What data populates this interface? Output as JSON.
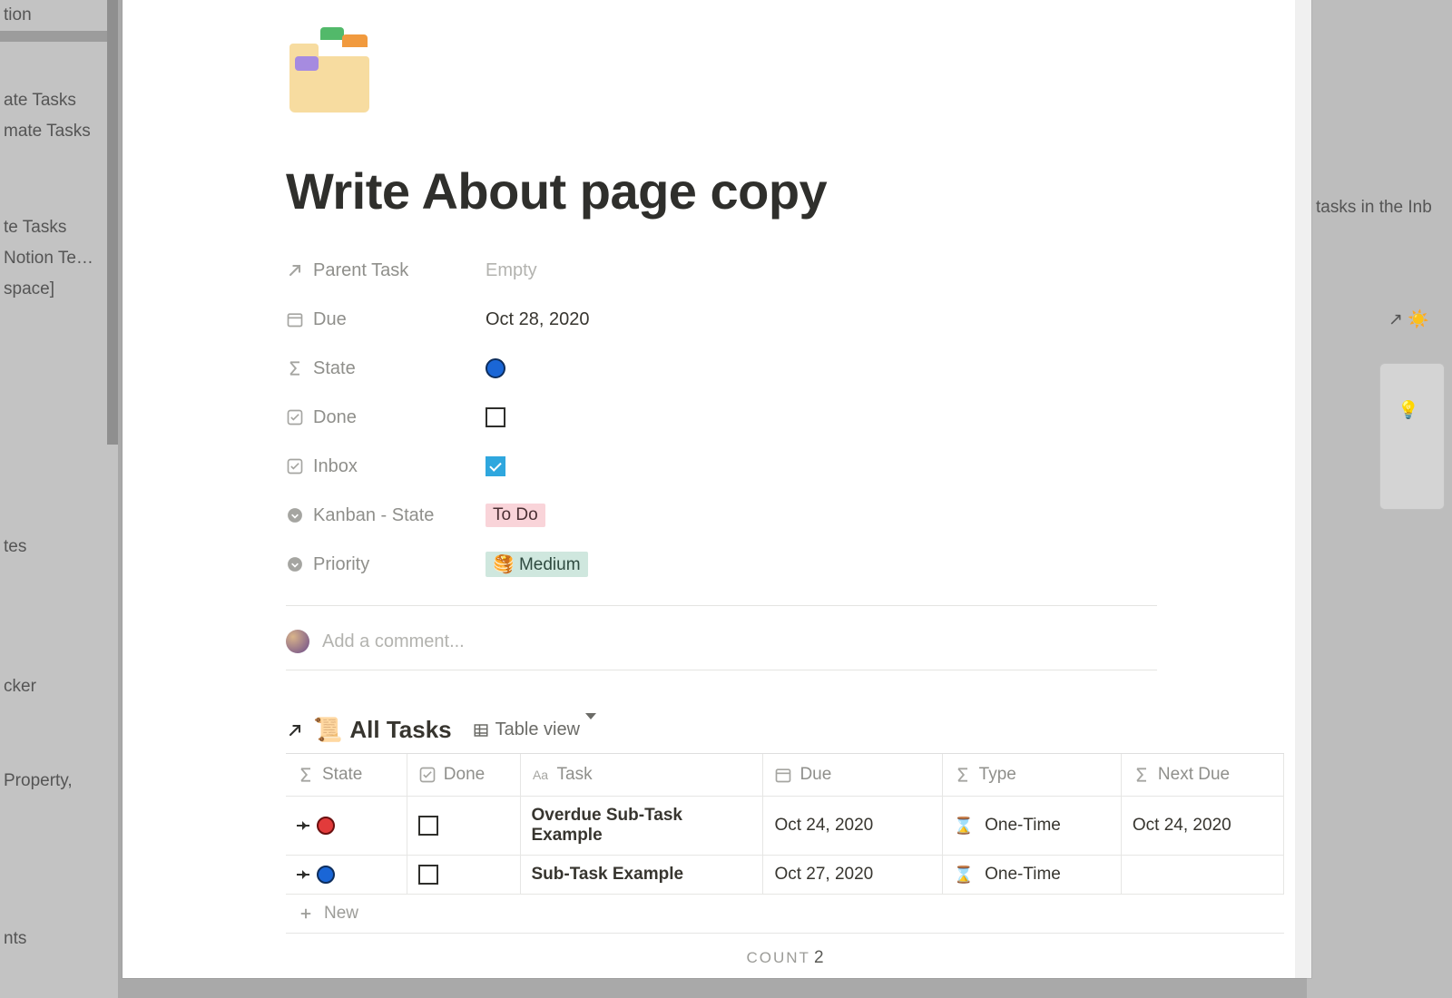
{
  "background": {
    "sidebar_items": [
      "tion",
      "",
      "ate Tasks",
      "mate Tasks",
      "",
      "",
      "te Tasks",
      "Notion Te…",
      "space]",
      "",
      "",
      "",
      "",
      "tes",
      "",
      "",
      "cker",
      "",
      "",
      "Property,",
      "",
      "",
      "",
      "nts"
    ],
    "right_text": "tasks in the Inb"
  },
  "page": {
    "title": "Write About page copy",
    "properties": {
      "parent_task": {
        "label": "Parent Task",
        "value": "",
        "placeholder": "Empty"
      },
      "due": {
        "label": "Due",
        "value": "Oct 28, 2020"
      },
      "state": {
        "label": "State",
        "color": "#1a66d6"
      },
      "done": {
        "label": "Done",
        "checked": false
      },
      "inbox": {
        "label": "Inbox",
        "checked": true
      },
      "kanban": {
        "label": "Kanban - State",
        "tag": "To Do"
      },
      "priority": {
        "label": "Priority",
        "tag": "Medium",
        "emoji": "🥞"
      }
    },
    "comment_placeholder": "Add a comment..."
  },
  "linked_db": {
    "title": "All Tasks",
    "title_emoji": "📜",
    "view_label": "Table view",
    "columns": {
      "state": "State",
      "done": "Done",
      "task": "Task",
      "due": "Due",
      "type": "Type",
      "next_due": "Next Due"
    },
    "rows": [
      {
        "state_color": "red",
        "done": false,
        "task": "Overdue Sub-Task Example",
        "due": "Oct 24, 2020",
        "type": "One-Time",
        "next_due": "Oct 24, 2020"
      },
      {
        "state_color": "blue",
        "done": false,
        "task": "Sub-Task Example",
        "due": "Oct 27, 2020",
        "type": "One-Time",
        "next_due": ""
      }
    ],
    "new_label": "New",
    "count_label": "COUNT",
    "count": 2
  }
}
